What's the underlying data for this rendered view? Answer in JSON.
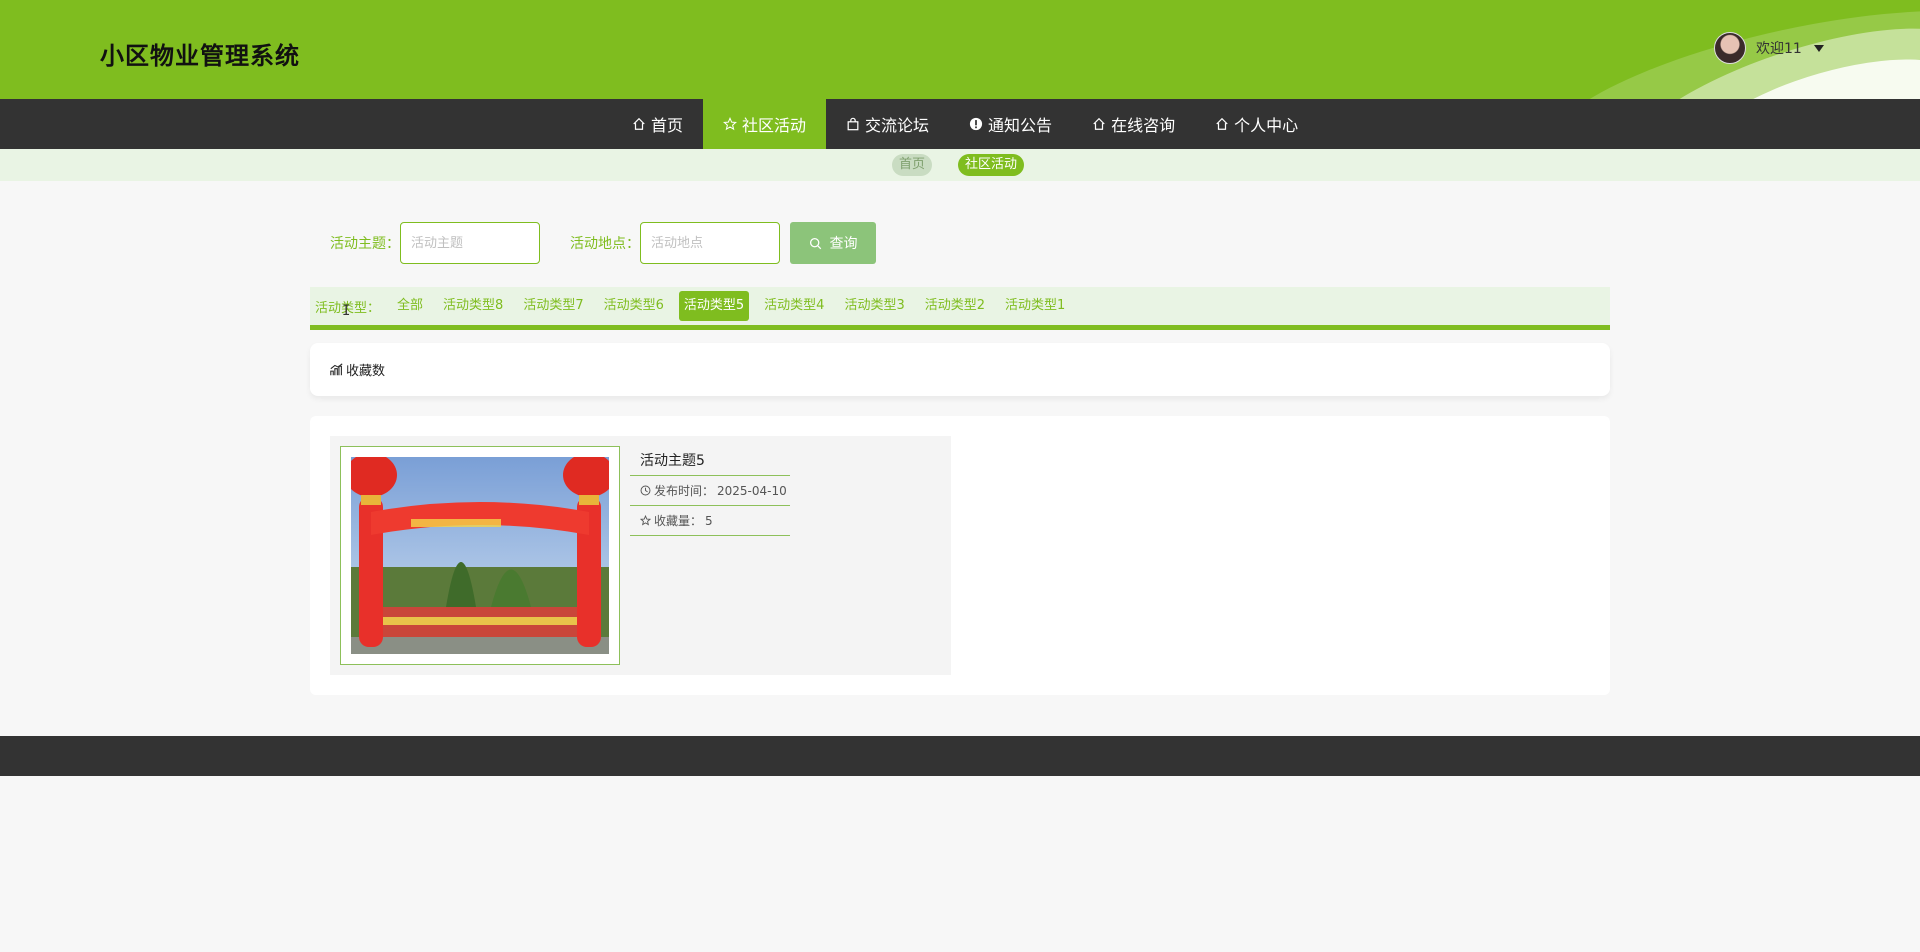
{
  "header": {
    "site_title": "小区物业管理系统",
    "welcome": "欢迎11"
  },
  "nav": {
    "items": [
      {
        "label": "首页",
        "icon": "home-icon"
      },
      {
        "label": "社区活动",
        "icon": "star-icon",
        "active": true
      },
      {
        "label": "交流论坛",
        "icon": "bag-icon"
      },
      {
        "label": "通知公告",
        "icon": "alert-icon"
      },
      {
        "label": "在线咨询",
        "icon": "home-icon"
      },
      {
        "label": "个人中心",
        "icon": "home-icon"
      }
    ]
  },
  "breadcrumb": {
    "home": "首页",
    "current": "社区活动"
  },
  "search": {
    "topic_label": "活动主题：",
    "topic_placeholder": "活动主题",
    "topic_value": "",
    "location_label": "活动地点：",
    "location_placeholder": "活动地点",
    "location_value": "",
    "button_label": "查询"
  },
  "types": {
    "label": "活动类型：",
    "items": [
      "全部",
      "活动类型8",
      "活动类型7",
      "活动类型6",
      "活动类型5",
      "活动类型4",
      "活动类型3",
      "活动类型2",
      "活动类型1"
    ],
    "active": "活动类型5"
  },
  "sort": {
    "label": "收藏数",
    "icon": "chart-icon"
  },
  "activities": [
    {
      "title": "活动主题5",
      "publish_label": "发布时间：",
      "publish_date": "2025-04-10",
      "fav_label": "收藏量：",
      "fav_count": "5",
      "image_icon": "red-arch-photo"
    }
  ],
  "colors": {
    "brand": "#7fbd1f",
    "nav_bg": "#333333",
    "breadcrumb_bg": "#e9f4e4",
    "search_button": "#8cc47a"
  }
}
